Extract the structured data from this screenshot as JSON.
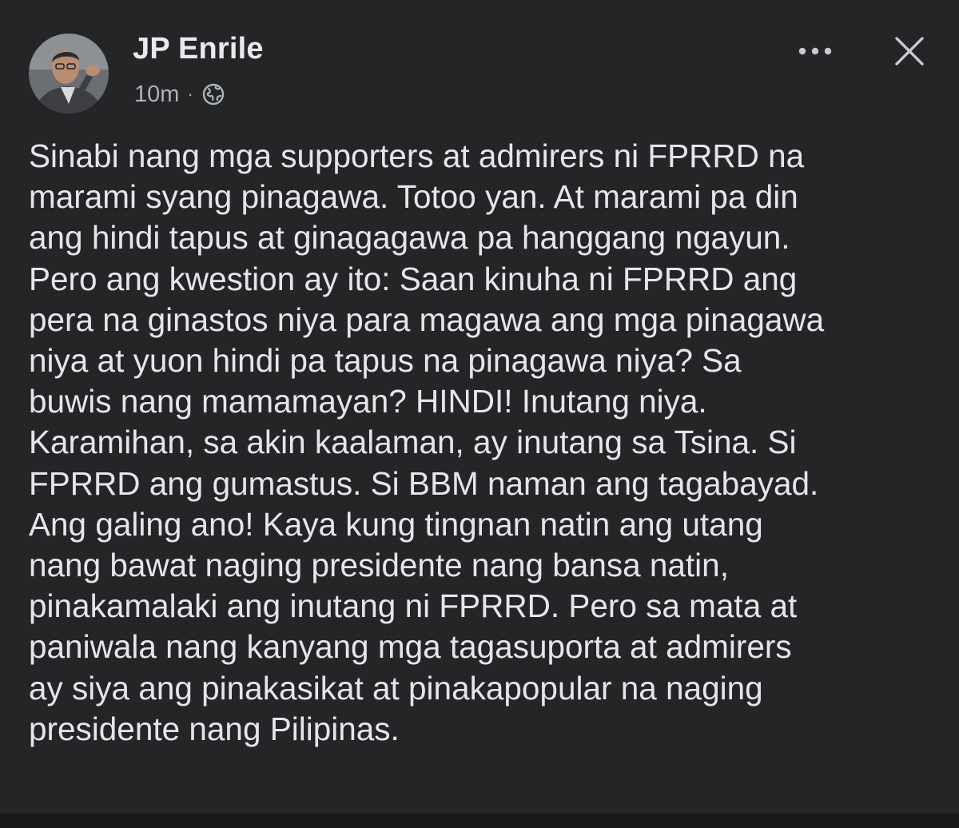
{
  "post": {
    "author": "JP Enrile",
    "time": "10m",
    "separator": "·",
    "privacy_icon": "globe-icon",
    "more_icon": "more-options-icon",
    "close_icon": "close-icon",
    "lines": [
      "Sinabi nang mga supporters at admirers ni FPRRD na",
      "marami syang pinagawa. Totoo yan. At marami pa din",
      "ang hindi tapus at ginagagawa pa hanggang ngayun.",
      "Pero ang kwestion ay ito: Saan kinuha ni FPRRD  ang",
      "pera na ginastos niya para magawa ang mga pinagawa",
      "niya at yuon hindi pa tapus na pinagawa niya? Sa",
      "buwis nang mamamayan? HINDI! Inutang niya.",
      "Karamihan, sa akin kaalaman, ay inutang sa Tsina. Si",
      "FPRRD  ang gumastus. Si BBM naman ang tagabayad.",
      "Ang galing ano! Kaya kung tingnan natin ang utang",
      "nang bawat naging presidente nang bansa natin,",
      "pinakamalaki ang inutang ni FPRRD. Pero sa mata at",
      "paniwala nang kanyang mga tagasuporta at admirers",
      "ay siya ang pinakasikat at pinakapopular na naging",
      "presidente nang Pilipinas."
    ]
  },
  "colors": {
    "background": "#242526",
    "text_primary": "#e4e6eb",
    "text_secondary": "#b0b3b8"
  }
}
